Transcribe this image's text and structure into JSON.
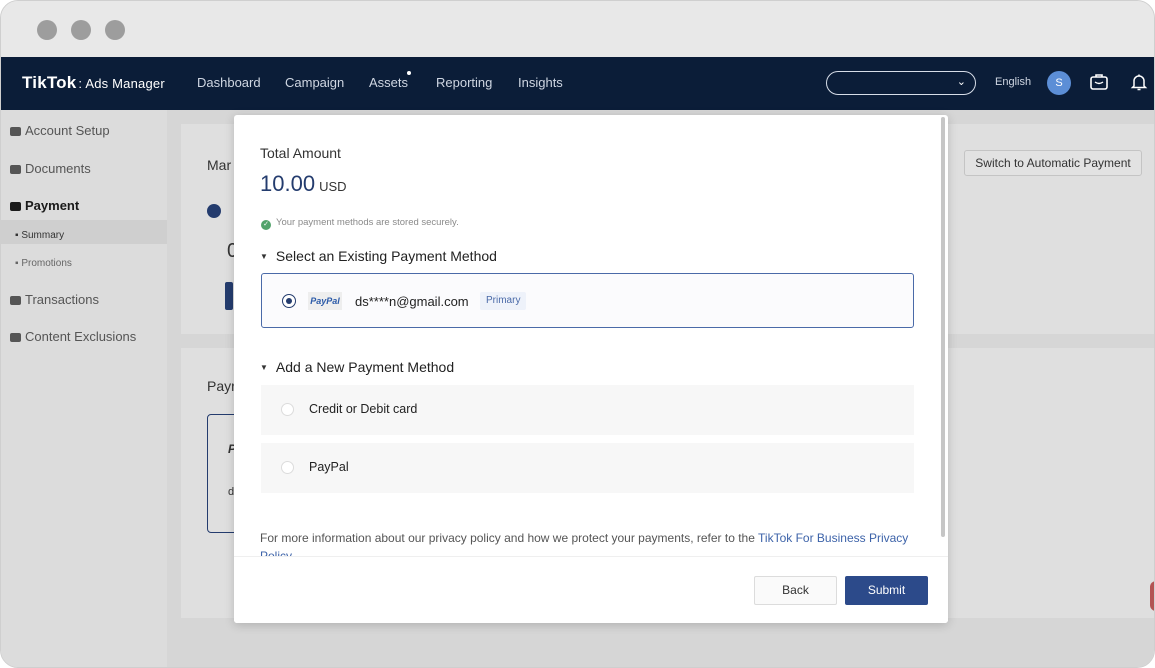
{
  "brand": {
    "name": "TikTok",
    "product": ": Ads Manager"
  },
  "nav": {
    "items": [
      "Dashboard",
      "Campaign",
      "Assets",
      "Reporting",
      "Insights"
    ],
    "language": "English",
    "avatar_initial": "S"
  },
  "sidebar": {
    "account_setup": "Account Setup",
    "documents": "Documents",
    "payment": "Payment",
    "summary": "Summary",
    "promotions": "Promotions",
    "transactions": "Transactions",
    "content_exclusions": "Content Exclusions"
  },
  "background": {
    "heading_fragment": "Mar",
    "balance_fragment": "0",
    "payment_heading_fragment": "Payr",
    "card_letter": "P",
    "card_letter2": "d",
    "switch_button": "Switch to Automatic Payment"
  },
  "modal": {
    "total_label": "Total Amount",
    "amount": "10.00",
    "currency": "USD",
    "secure_note": "Your payment methods are stored securely.",
    "existing_title": "Select an Existing Payment Method",
    "existing_method": {
      "logo": "PayPal",
      "email": "ds****n@gmail.com",
      "badge": "Primary"
    },
    "new_title": "Add a New Payment Method",
    "new_options": [
      "Credit or Debit card",
      "PayPal"
    ],
    "policy_text": "For more information about our privacy policy and how we protect your payments, refer to the ",
    "policy_link": "TikTok For Business Privacy Policy",
    "back_label": "Back",
    "submit_label": "Submit"
  },
  "colors": {
    "navbar": "#0b1d38",
    "accent": "#243c6e",
    "submit": "#2c4a8a"
  }
}
